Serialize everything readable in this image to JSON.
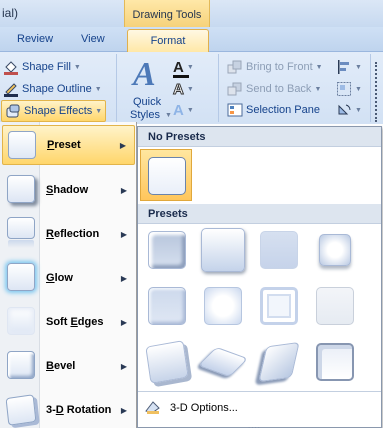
{
  "titlebar": {
    "fragment": "ial)"
  },
  "context_group": {
    "label": "Drawing Tools"
  },
  "tabs": [
    {
      "label": "Review"
    },
    {
      "label": "View"
    },
    {
      "label": "Format"
    }
  ],
  "ribbon": {
    "shape_fill": "Shape Fill",
    "shape_outline": "Shape Outline",
    "shape_effects": "Shape Effects",
    "quick_styles_line1": "Quick",
    "quick_styles_line2": "Styles",
    "bring_to_front": "Bring to Front",
    "send_to_back": "Send to Back",
    "selection_pane": "Selection Pane"
  },
  "submenu": {
    "items": [
      {
        "label": "Preset",
        "mnemonic": "P",
        "rest": "reset"
      },
      {
        "label": "Shadow",
        "mnemonic": "S",
        "rest": "hadow"
      },
      {
        "label": "Reflection",
        "mnemonic": "R",
        "rest": "eflection"
      },
      {
        "label": "Glow",
        "mnemonic": "G",
        "rest": "low"
      },
      {
        "label": "Soft Edges",
        "mnemonic": "E",
        "pre": "Soft ",
        "rest": "dges"
      },
      {
        "label": "Bevel",
        "mnemonic": "B",
        "rest": "evel"
      },
      {
        "label": "3-D Rotation",
        "mnemonic": "D",
        "pre": "3-",
        "rest": " Rotation"
      }
    ]
  },
  "gallery": {
    "no_presets_header": "No Presets",
    "presets_header": "Presets",
    "footer_option": "3-D Options...",
    "grip": "...."
  },
  "colors": {
    "hover_gradient_top": "#fff3c9",
    "hover_gradient_bottom": "#ffd66b",
    "ribbon_text": "#15428b",
    "context_tab": "#f6d27b"
  }
}
